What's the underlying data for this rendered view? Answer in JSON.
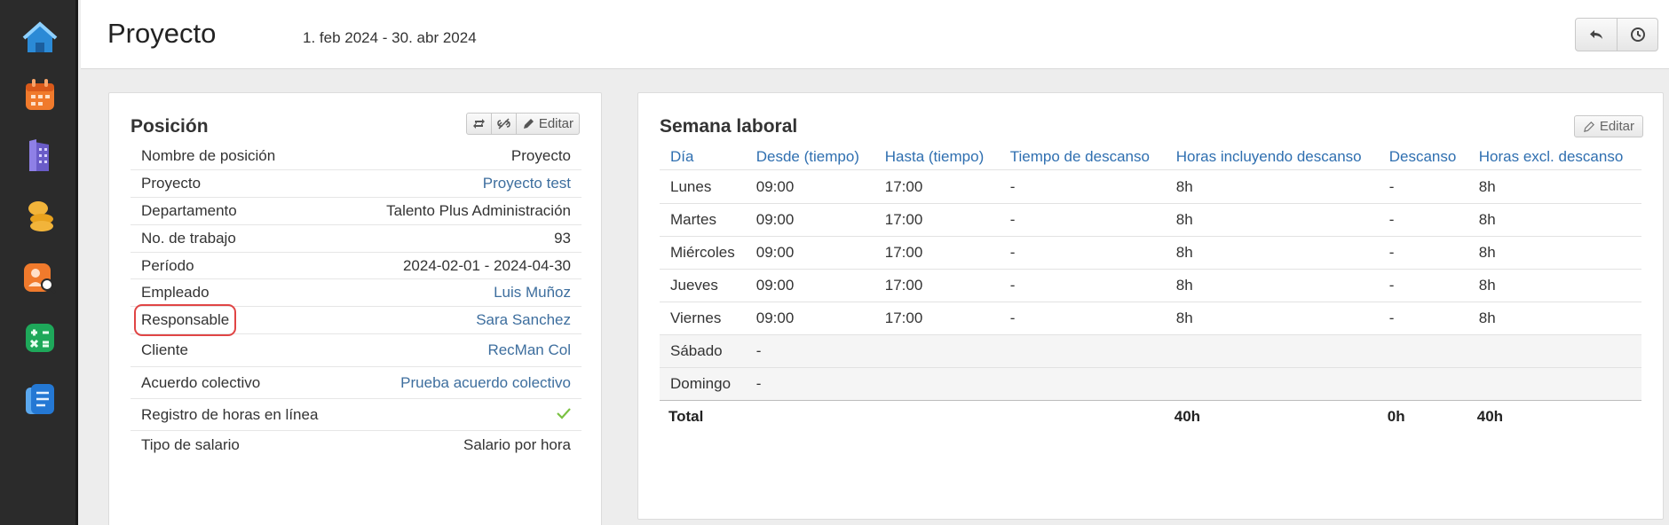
{
  "rail": {
    "items": [
      {
        "icon": "home-icon",
        "color": "#2b8ad6"
      },
      {
        "icon": "calendar-icon",
        "color": "#f07a2c"
      },
      {
        "icon": "building-icon",
        "color": "#6a5cc8"
      },
      {
        "icon": "coins-icon",
        "color": "#f2b43a"
      },
      {
        "icon": "person-search-icon",
        "color": "#f07a2c"
      },
      {
        "icon": "calculator-icon",
        "color": "#1ea85a"
      },
      {
        "icon": "document-icon",
        "color": "#2478d4"
      }
    ]
  },
  "header": {
    "title": "Proyecto",
    "subtitle": "1. feb 2024 - 30. abr 2024",
    "buttons": [
      {
        "icon": "undo-icon"
      },
      {
        "icon": "clock-icon"
      }
    ]
  },
  "position": {
    "title": "Posición",
    "tools": {
      "edit_label": "Editar"
    },
    "rows": [
      {
        "label": "Nombre de posición",
        "value": "Proyecto",
        "link": false
      },
      {
        "label": "Proyecto",
        "value": "Proyecto test",
        "link": true
      },
      {
        "label": "Departamento",
        "value": "Talento Plus Administración",
        "link": false
      },
      {
        "label": "No. de trabajo",
        "value": "93",
        "link": false
      },
      {
        "label": "Período",
        "value": "2024-02-01 - 2024-04-30",
        "link": false
      },
      {
        "label": "Empleado",
        "value": "Luis Muñoz",
        "link": true
      },
      {
        "label": "Responsable",
        "value": "Sara Sanchez",
        "link": true
      },
      {
        "label": "Cliente",
        "value": "RecMan Col",
        "link": true
      },
      {
        "label": "Acuerdo colectivo",
        "value": "Prueba acuerdo colectivo",
        "link": true
      },
      {
        "label": "Registro de horas en línea",
        "value": "",
        "link": false
      },
      {
        "label": "Tipo de salario",
        "value": "Salario por hora",
        "link": false
      }
    ],
    "check_color": "#7ac142"
  },
  "week": {
    "title": "Semana laboral",
    "edit_label": "Editar",
    "headers": [
      "Día",
      "Desde (tiempo)",
      "Hasta (tiempo)",
      "Tiempo de descanso",
      "Horas incluyendo descanso",
      "Descanso",
      "Horas excl. descanso"
    ],
    "rows": [
      [
        "Lunes",
        "09:00",
        "17:00",
        "-",
        "8h",
        "-",
        "8h"
      ],
      [
        "Martes",
        "09:00",
        "17:00",
        "-",
        "8h",
        "-",
        "8h"
      ],
      [
        "Miércoles",
        "09:00",
        "17:00",
        "-",
        "8h",
        "-",
        "8h"
      ],
      [
        "Jueves",
        "09:00",
        "17:00",
        "-",
        "8h",
        "-",
        "8h"
      ],
      [
        "Viernes",
        "09:00",
        "17:00",
        "-",
        "8h",
        "-",
        "8h"
      ],
      [
        "Sábado",
        "-",
        "",
        "",
        "",
        "",
        ""
      ],
      [
        "Domingo",
        "-",
        "",
        "",
        "",
        "",
        ""
      ]
    ],
    "total": {
      "label": "Total",
      "incl": "40h",
      "break": "0h",
      "excl": "40h"
    }
  }
}
